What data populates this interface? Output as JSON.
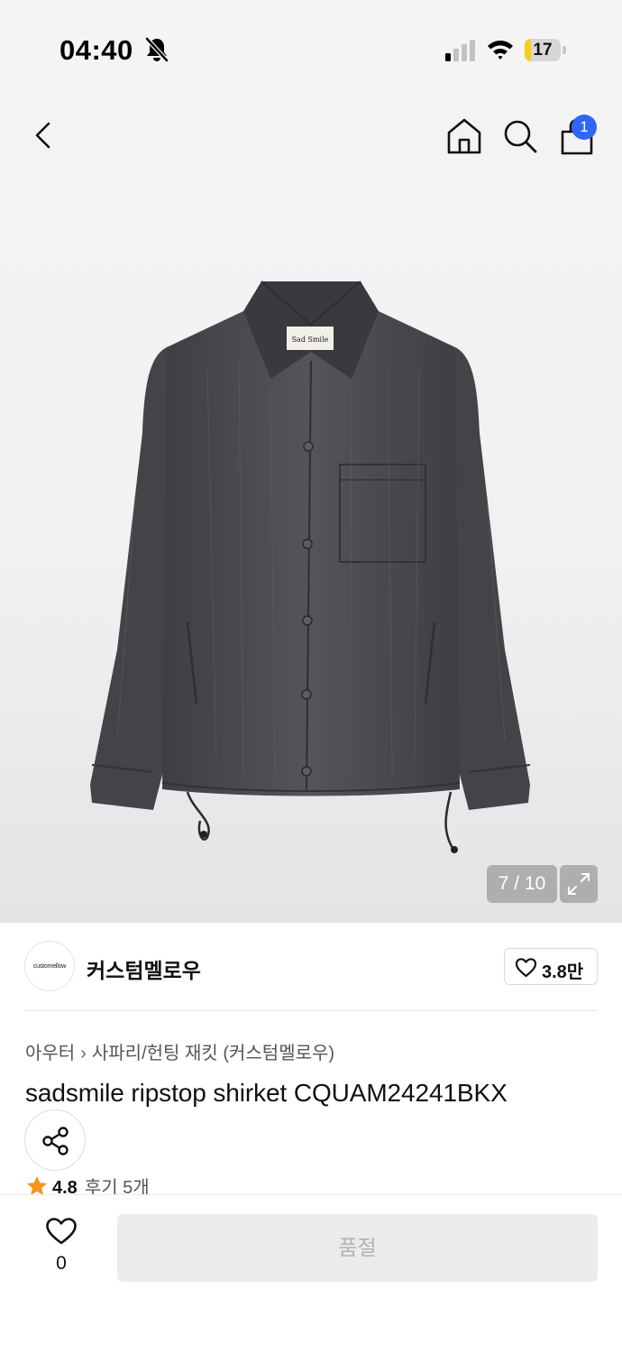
{
  "status_bar": {
    "time": "04:40",
    "battery_level": "17",
    "battery_fraction": 0.17,
    "icons": [
      "bell-slash-icon",
      "cellular-signal-icon",
      "wifi-icon",
      "battery-icon"
    ]
  },
  "nav": {
    "icons": [
      "chevron-left-icon",
      "home-icon",
      "search-icon",
      "shopping-bag-icon"
    ],
    "cart_badge": "1"
  },
  "gallery": {
    "counter": "7 / 10",
    "product_label_text": "Sad Smile"
  },
  "brand": {
    "logo_text": "customellow",
    "name": "커스텀멜로우",
    "like_count": "3.8만"
  },
  "product": {
    "breadcrumb": [
      "아우터",
      "사파리/헌팅 재킷 (커스텀멜로우)"
    ],
    "title": "sadsmile ripstop shirket CQUAM24241BKX",
    "rating": "4.8",
    "review_label": "후기 5개"
  },
  "bottom_bar": {
    "wish_count": "0",
    "soldout_label": "품절"
  },
  "colors": {
    "accent_badge": "#2f66f6",
    "battery_yellow": "#f7ce17",
    "star": "#f7941d",
    "jacket": "#4a494d"
  }
}
